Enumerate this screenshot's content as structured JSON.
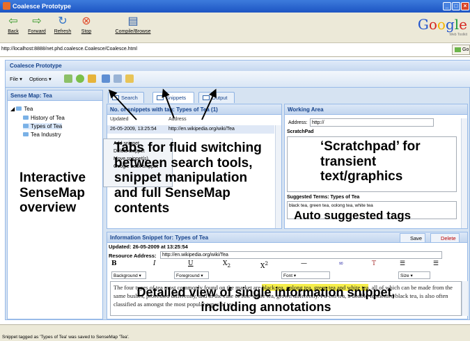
{
  "window": {
    "title": "Coalesce Prototype"
  },
  "toolbar": {
    "back": "Back",
    "forward": "Forward",
    "refresh": "Refresh",
    "stop": "Stop",
    "compile": "Compile/Browse",
    "google": "Google",
    "google_sub": "Web Toolkit"
  },
  "address": {
    "url": "http://localhost:8888/net.phd.coalesce.Coalesce/Coalesce.html",
    "go": "Go"
  },
  "app": {
    "title": "Coalesce Prototype",
    "menu_file": "File",
    "menu_options": "Options"
  },
  "sensemap": {
    "title": "Sense Map: Tea",
    "root": "Tea",
    "items": [
      "History of Tea",
      "Types of Tea",
      "Tea Industry"
    ]
  },
  "tabs": [
    "Search",
    "Snippets",
    "Output"
  ],
  "snippets": {
    "title": "No. of snippets with tag: Types of Tea (1)",
    "columns": [
      "Updated",
      "Address"
    ],
    "rows": [
      {
        "updated": "26-05-2009, 13:25:54",
        "address": "http://en.wikipedia.org/wiki/Tea"
      }
    ],
    "menu": [
      "Add snippet",
      "Delete snippet",
      "Move snippet(s)",
      "Google back snippet"
    ]
  },
  "working": {
    "title": "Working Area",
    "address_label": "Address:",
    "address_value": "http://",
    "scratchpad": "ScratchPad",
    "suggested_label": "Suggested Terms: Types of Tea",
    "suggested_value": "black tea, green tea, oolong tea, white tea"
  },
  "info": {
    "title": "Information Snippet for: Types of Tea",
    "updated": "Updated: 26-05-2009 at 13:25:54",
    "resource_label": "Resource Address:",
    "resource_value": "http://en.wikipedia.org/wiki/Tea",
    "save": "Save",
    "delete": "Delete",
    "background": "Background",
    "foreground": "Foreground",
    "font": "Font",
    "size": "Size",
    "text_before": "The four types of tea most commonly found on the market are ",
    "text_highlight": "black tea, oolong tea, green tea and white tea",
    "text_after": ", all of which can be made from the same bushes, processed differently, and in the case of fine white tea, grown differently. Pu-erh tea, a double-fermented black tea, is also often classified as amongst the most popular types of tea."
  },
  "status": "Snippet tagged as 'Types of Tea' was saved to SenseMap 'Tea'.",
  "annotations": {
    "tabs": "Tabs for fluid switching between search tools, snippet manipulation and full SenseMap contents",
    "scratchpad": "‘Scratchpad’ for transient text/graphics",
    "tags": "Auto suggested tags",
    "overview": "Interactive SenseMap overview",
    "detail": "Detailed view of single information snippet, including annotations"
  }
}
